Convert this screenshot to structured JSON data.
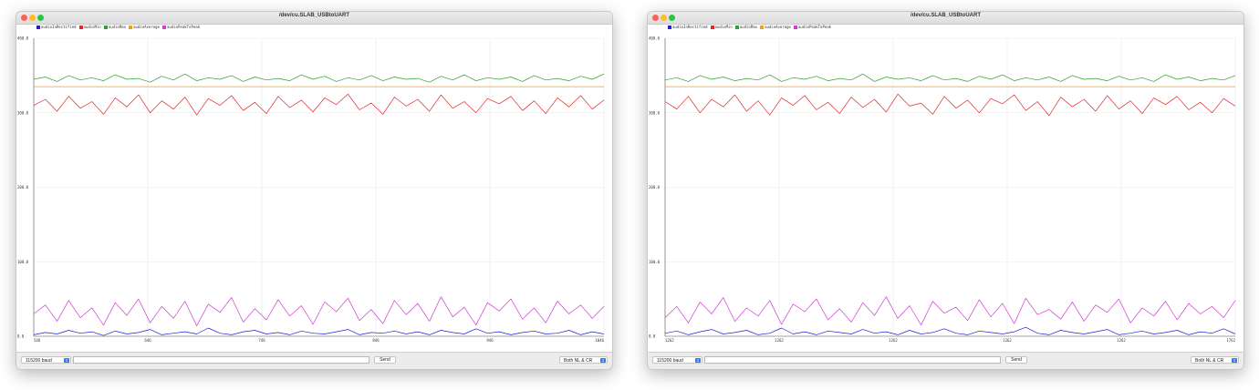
{
  "windows": [
    {
      "title": "/dev/cu.SLAB_USBtoUART",
      "baud": "115200 baud",
      "send_label": "Send",
      "line_ending": "Both NL & CR",
      "message_value": "",
      "chart_data": {
        "type": "line",
        "legend_placement": "top-left",
        "ylim": [
          0,
          400
        ],
        "y_ticks": [
          "0.0",
          "100.0",
          "200.0",
          "300.0",
          "400.0"
        ],
        "xlim": [
          546,
          1046
        ],
        "x_ticks": [
          {
            "value": 546,
            "label": "546"
          },
          {
            "value": 646,
            "label": "646"
          },
          {
            "value": 746,
            "label": "746"
          },
          {
            "value": 846,
            "label": "846"
          },
          {
            "value": 946,
            "label": "946"
          },
          {
            "value": 1046,
            "label": "1046"
          }
        ],
        "grid": true,
        "series": [
          {
            "name": "audioInRectified",
            "color": "#1f1fd6",
            "values": [
              2,
              5,
              3,
              8,
              4,
              6,
              1,
              7,
              3,
              5,
              9,
              2,
              4,
              6,
              3,
              11,
              4,
              2,
              6,
              8,
              3,
              5,
              2,
              7,
              4,
              3,
              6,
              9,
              2,
              5,
              4,
              7,
              3,
              6,
              2,
              8,
              5,
              3,
              10,
              4,
              6,
              2,
              5,
              7,
              3,
              4,
              8,
              2,
              6,
              3
            ]
          },
          {
            "name": "audioMin",
            "color": "#e32626",
            "values": [
              310,
              318,
              302,
              322,
              306,
              315,
              298,
              320,
              308,
              324,
              300,
              316,
              305,
              321,
              297,
              319,
              310,
              323,
              303,
              314,
              299,
              322,
              307,
              317,
              301,
              320,
              311,
              325,
              304,
              313,
              298,
              321,
              309,
              318,
              302,
              324,
              306,
              315,
              300,
              319,
              312,
              322,
              303,
              316,
              299,
              320,
              308,
              323,
              305,
              317
            ]
          },
          {
            "name": "audioMax",
            "color": "#2f9e2f",
            "values": [
              345,
              348,
              342,
              350,
              344,
              347,
              343,
              351,
              345,
              346,
              341,
              349,
              344,
              352,
              343,
              347,
              345,
              350,
              342,
              348,
              344,
              346,
              343,
              351,
              345,
              349,
              342,
              347,
              344,
              350,
              343,
              348,
              345,
              346,
              341,
              349,
              344,
              351,
              343,
              347,
              345,
              348,
              342,
              350,
              344,
              346,
              343,
              349,
              345,
              352
            ]
          },
          {
            "name": "audioAverage",
            "color": "#f0a020",
            "values": [
              335,
              335,
              335,
              335,
              335,
              335,
              335,
              335,
              335,
              335,
              335,
              335,
              335,
              335,
              335,
              335,
              335,
              335,
              335,
              335,
              335,
              335,
              335,
              335,
              335,
              335,
              335,
              335,
              335,
              335,
              335,
              335,
              335,
              335,
              335,
              335,
              335,
              335,
              335,
              335,
              335,
              335,
              335,
              335,
              335,
              335,
              335,
              335,
              335,
              335
            ]
          },
          {
            "name": "audioPeakToPeak",
            "color": "#d23ad2",
            "values": [
              30,
              42,
              20,
              48,
              25,
              38,
              15,
              45,
              28,
              50,
              18,
              40,
              24,
              47,
              14,
              43,
              32,
              52,
              19,
              37,
              22,
              49,
              27,
              41,
              16,
              46,
              33,
              51,
              21,
              36,
              17,
              48,
              29,
              44,
              20,
              53,
              26,
              39,
              15,
              45,
              34,
              50,
              23,
              38,
              18,
              47,
              30,
              42,
              24,
              40
            ]
          }
        ]
      }
    },
    {
      "title": "/dev/cu.SLAB_USBtoUART",
      "baud": "115200 baud",
      "send_label": "Send",
      "line_ending": "Both NL & CR",
      "message_value": "",
      "chart_data": {
        "type": "line",
        "legend_placement": "top-left",
        "ylim": [
          0,
          400
        ],
        "y_ticks": [
          "0.0",
          "100.0",
          "200.0",
          "300.0",
          "400.0"
        ],
        "xlim": [
          0,
          5
        ],
        "x_ticks": [
          {
            "value": 0,
            "label": "1262"
          },
          {
            "value": 1,
            "label": "1262"
          },
          {
            "value": 2,
            "label": "1262"
          },
          {
            "value": 3,
            "label": "1262"
          },
          {
            "value": 4,
            "label": "1262"
          },
          {
            "value": 5,
            "label": "1762"
          }
        ],
        "grid": true,
        "series": [
          {
            "name": "audioInRectified",
            "color": "#1f1fd6",
            "values": [
              4,
              7,
              2,
              6,
              9,
              3,
              5,
              8,
              2,
              4,
              11,
              3,
              6,
              2,
              7,
              5,
              3,
              9,
              4,
              6,
              2,
              8,
              3,
              5,
              10,
              4,
              2,
              7,
              5,
              3,
              6,
              12,
              4,
              2,
              8,
              5,
              3,
              6,
              9,
              2,
              4,
              7,
              3,
              5,
              8,
              2,
              6,
              4,
              10,
              3
            ]
          },
          {
            "name": "audioMin",
            "color": "#e32626",
            "values": [
              315,
              305,
              322,
              300,
              318,
              308,
              324,
              302,
              316,
              297,
              320,
              310,
              323,
              304,
              314,
              299,
              321,
              307,
              318,
              301,
              325,
              309,
              313,
              298,
              322,
              306,
              317,
              300,
              319,
              312,
              324,
              303,
              315,
              296,
              321,
              308,
              318,
              302,
              323,
              305,
              316,
              299,
              320,
              311,
              322,
              304,
              314,
              300,
              319,
              309
            ]
          },
          {
            "name": "audioMax",
            "color": "#2f9e2f",
            "values": [
              344,
              347,
              342,
              350,
              345,
              348,
              343,
              346,
              344,
              351,
              342,
              347,
              345,
              349,
              343,
              346,
              344,
              352,
              342,
              348,
              345,
              347,
              343,
              350,
              344,
              346,
              342,
              349,
              345,
              351,
              343,
              347,
              344,
              348,
              342,
              350,
              345,
              346,
              343,
              349,
              344,
              347,
              342,
              351,
              345,
              348,
              343,
              346,
              344,
              350
            ]
          },
          {
            "name": "audioAverage",
            "color": "#f0a020",
            "values": [
              335,
              335,
              335,
              335,
              335,
              335,
              335,
              335,
              335,
              335,
              335,
              335,
              335,
              335,
              335,
              335,
              335,
              335,
              335,
              335,
              335,
              335,
              335,
              335,
              335,
              335,
              335,
              335,
              335,
              335,
              335,
              335,
              335,
              335,
              335,
              335,
              335,
              335,
              335,
              335,
              335,
              335,
              335,
              335,
              335,
              335,
              335,
              335,
              335,
              335
            ]
          },
          {
            "name": "audioPeakToPeak",
            "color": "#d23ad2",
            "values": [
              25,
              40,
              18,
              46,
              30,
              52,
              20,
              38,
              27,
              48,
              16,
              43,
              33,
              50,
              22,
              37,
              19,
              45,
              28,
              53,
              24,
              41,
              15,
              47,
              31,
              39,
              21,
              49,
              26,
              44,
              17,
              51,
              29,
              36,
              23,
              46,
              20,
              42,
              32,
              50,
              18,
              38,
              27,
              47,
              22,
              44,
              30,
              40,
              25,
              48
            ]
          }
        ]
      }
    }
  ]
}
